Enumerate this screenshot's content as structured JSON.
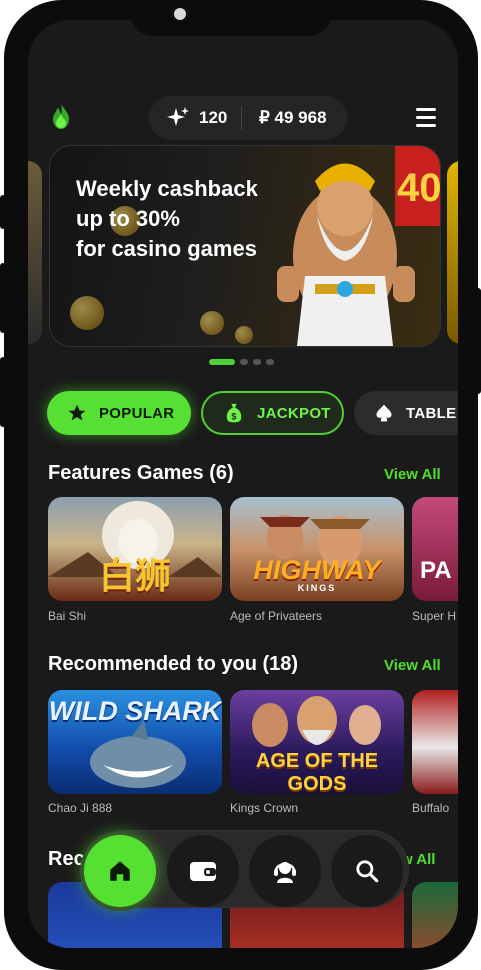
{
  "header": {
    "bonus_points": "120",
    "balance": "₽ 49 968"
  },
  "banner": {
    "line1": "Weekly cashback",
    "line2": "up to 30%",
    "line3": "for casino games",
    "badge": "40"
  },
  "carousel": {
    "active_index": 0,
    "count": 4
  },
  "categories": [
    {
      "label": "POPULAR",
      "icon": "star-icon"
    },
    {
      "label": "JACKPOT",
      "icon": "money-bag-icon"
    },
    {
      "label": "TABLE",
      "icon": "spade-icon"
    }
  ],
  "sections": {
    "featured": {
      "title": "Features Games (6)",
      "view_all": "View All",
      "games": [
        {
          "name": "Bai Shi",
          "art_text": "白狮"
        },
        {
          "name": "Age of Privateers",
          "art_text": "HIGHWAY",
          "art_sub": "KINGS"
        },
        {
          "name": "Super H",
          "art_text": "PA"
        }
      ]
    },
    "recommended": {
      "title": "Recommended to you (18)",
      "view_all": "View All",
      "games": [
        {
          "name": "Chao Ji 888",
          "art_text": "WILD SHARK"
        },
        {
          "name": "Kings Crown",
          "art_text": "AGE OF THE GODS"
        },
        {
          "name": "Buffalo",
          "art_text": ""
        }
      ]
    },
    "third": {
      "title": "Rec",
      "view_all": "w All"
    }
  },
  "bottom_nav": [
    {
      "icon": "home-icon"
    },
    {
      "icon": "wallet-icon"
    },
    {
      "icon": "support-icon"
    },
    {
      "icon": "search-icon"
    }
  ],
  "colors": {
    "accent": "#56e033",
    "background": "#1a1a1a",
    "card": "#2a2a2a"
  }
}
